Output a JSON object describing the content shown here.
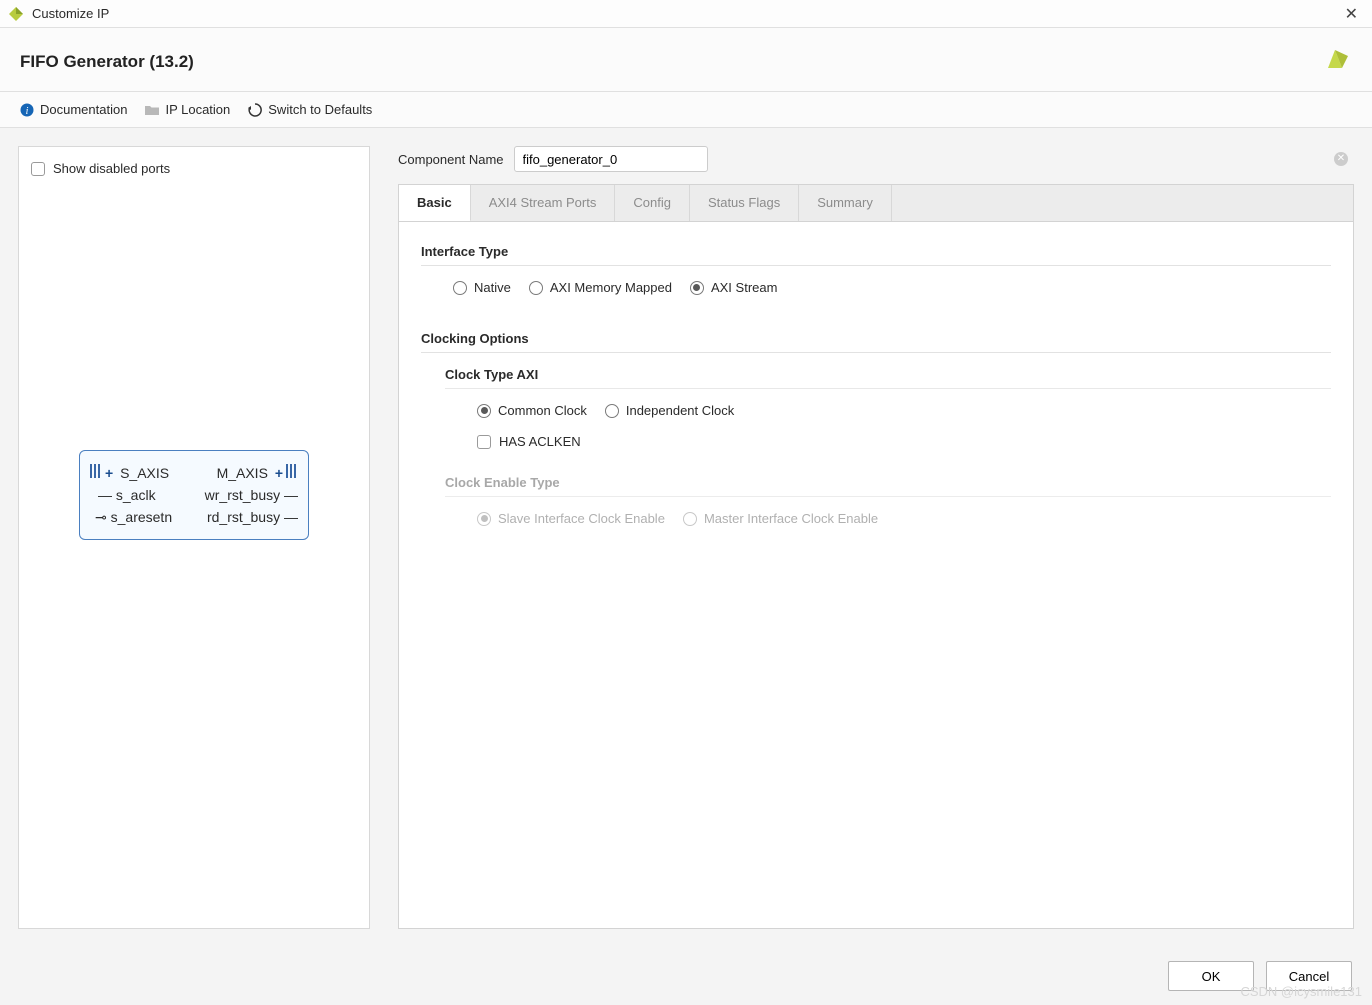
{
  "window": {
    "title": "Customize IP"
  },
  "header": {
    "title": "FIFO Generator (13.2)"
  },
  "toolbar": {
    "documentation": "Documentation",
    "ip_location": "IP Location",
    "switch_defaults": "Switch to Defaults"
  },
  "left": {
    "show_disabled_ports": "Show disabled ports",
    "block": {
      "left_ports": [
        "S_AXIS",
        "s_aclk",
        "s_aresetn"
      ],
      "right_ports": [
        "M_AXIS",
        "wr_rst_busy",
        "rd_rst_busy"
      ]
    }
  },
  "component_name": {
    "label": "Component Name",
    "value": "fifo_generator_0"
  },
  "tabs": {
    "items": [
      "Basic",
      "AXI4 Stream Ports",
      "Config",
      "Status Flags",
      "Summary"
    ],
    "active": "Basic"
  },
  "basic": {
    "interface_type": {
      "title": "Interface Type",
      "options": [
        "Native",
        "AXI Memory Mapped",
        "AXI Stream"
      ],
      "selected": "AXI Stream"
    },
    "clocking": {
      "title": "Clocking Options",
      "clock_type": {
        "title": "Clock Type AXI",
        "options": [
          "Common Clock",
          "Independent Clock"
        ],
        "selected": "Common Clock"
      },
      "has_aclken": {
        "label": "HAS ACLKEN",
        "checked": false
      },
      "clock_enable_type": {
        "title": "Clock Enable Type",
        "options": [
          "Slave Interface Clock Enable",
          "Master Interface Clock Enable"
        ],
        "selected": "Slave Interface Clock Enable",
        "disabled": true
      }
    }
  },
  "footer": {
    "ok": "OK",
    "cancel": "Cancel"
  },
  "watermark": "CSDN @icysmile131"
}
